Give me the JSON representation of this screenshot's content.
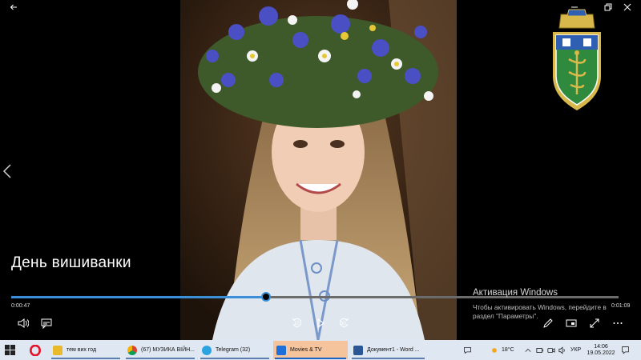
{
  "window": {
    "back_icon": "back-arrow-icon",
    "minimize_icon": "minimize-icon",
    "maximize_icon": "restore-icon",
    "close_icon": "close-icon"
  },
  "video": {
    "title": "День вишиванки",
    "elapsed": "0:00:47",
    "duration": "0:01:09",
    "progress_fraction": 0.42
  },
  "activation": {
    "title": "Активация Windows",
    "body": "Чтобы активировать Windows, перейдите в раздел \"Параметры\"."
  },
  "controls": {
    "skip_back_seconds": "10",
    "skip_forward_seconds": "30"
  },
  "taskbar": {
    "apps": [
      {
        "label": "тем вих год",
        "color": "#e8b928"
      },
      {
        "label": "(67) МУЗИКА ВІЙН...",
        "color": "#db4437"
      },
      {
        "label": "Telegram (32)",
        "color": "#2aa3e0"
      },
      {
        "label": "Movies & TV",
        "color": "#1e6fd9"
      },
      {
        "label": "Документ1 - Word ...",
        "color": "#2b5797"
      }
    ],
    "weather": "18°C",
    "language": "УКР",
    "time": "14:06",
    "date": "19.05.2022"
  },
  "colors": {
    "accent": "#3b8fd8",
    "taskbar_bg": "#dfe8f2",
    "active_app_bg": "#f5c39c"
  }
}
